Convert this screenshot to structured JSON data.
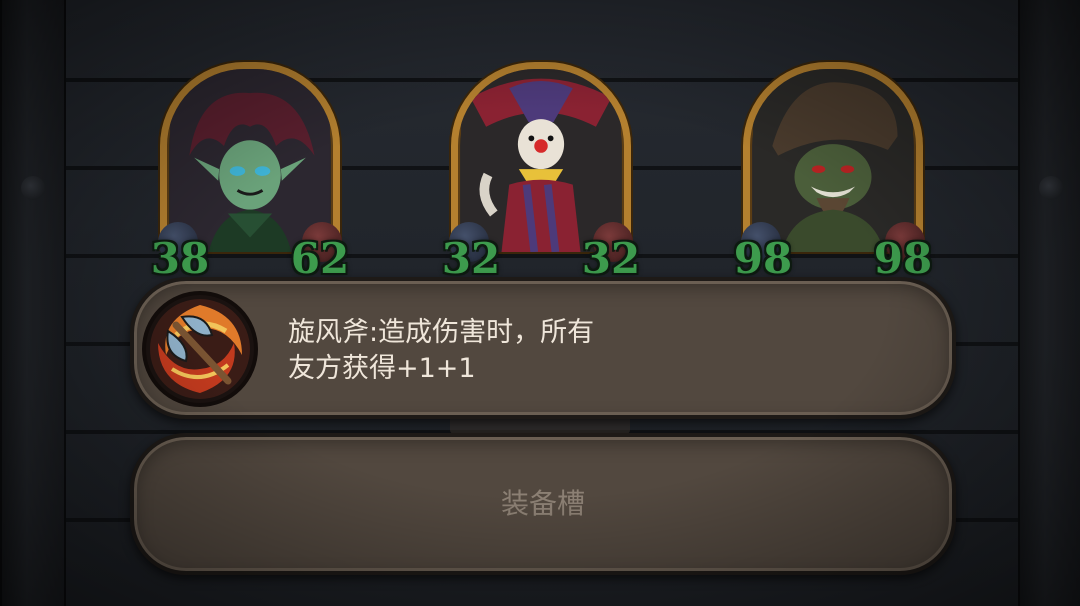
{
  "heroes": [
    {
      "name": "dark-haired-elf",
      "attack": "38",
      "health": "62"
    },
    {
      "name": "clown",
      "attack": "32",
      "health": "32"
    },
    {
      "name": "goblin",
      "attack": "98",
      "health": "98"
    }
  ],
  "equipment": {
    "description_line1": "旋风斧:造成伤害时，所有",
    "description_line2": "友方获得+1+1",
    "icon": "whirlwind-axe-icon",
    "slot_label": "装备槽"
  },
  "colors": {
    "stat_green": "#3d9b4d",
    "frame_gold": "#b4802f",
    "panel_brown": "#52483f"
  }
}
